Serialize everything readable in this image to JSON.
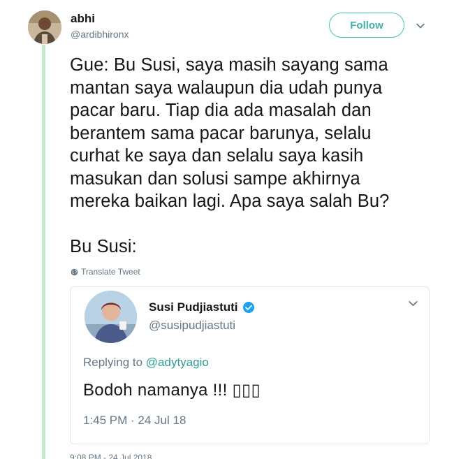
{
  "tweet": {
    "author_name": "abhi",
    "author_handle": "@ardibhironx",
    "follow_label": "Follow",
    "text": "Gue: Bu Susi, saya masih sayang sama\nmantan saya walaupun dia udah punya\npacar baru. Tiap dia ada masalah dan\nberantem sama pacar barunya, selalu\ncurhat ke saya dan selalu saya kasih\nmasukan dan solusi sampe akhirnya\nmereka baikan lagi. Apa saya salah Bu?\n\nBu Susi:",
    "translate_label": "Translate Tweet",
    "timestamp": "9:08 PM - 24 Jul 2018"
  },
  "quoted": {
    "author_name": "Susi Pudjiastuti",
    "author_handle": "@susipudjiastuti",
    "replying_prefix": "Replying to ",
    "replying_to": "@adytyagio",
    "text": "Bodoh namanya !!! ▯▯▯",
    "timestamp": "1:45 PM · 24 Jul 18"
  },
  "colors": {
    "accent": "#4ac2b8",
    "link": "#2f9c8f",
    "secondary_text": "#657786",
    "verified": "#1da1f2"
  },
  "icons": [
    "chevron-down-icon",
    "globe-icon",
    "verified-badge-icon"
  ]
}
